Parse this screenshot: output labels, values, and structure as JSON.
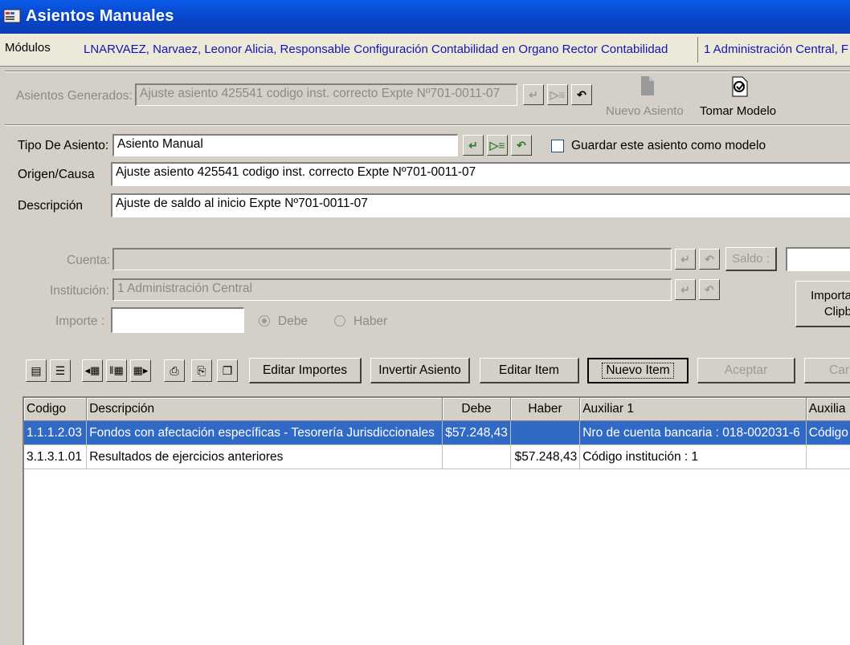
{
  "window": {
    "title": "Asientos Manuales"
  },
  "modules_bar": {
    "label": "Módulos",
    "user": "LNARVAEZ, Narvaez, Leonor Alicia, Responsable Configuración Contabilidad en Organo Rector Contabilidad",
    "institution": "1 Administración Central, F"
  },
  "generated": {
    "label": "Asientos Generados:",
    "value": "Ajuste asiento 425541 codigo inst. correcto Expte Nº701-0011-07",
    "new_entry_label": "Nuevo Asiento",
    "take_model_label": "Tomar Modelo"
  },
  "form": {
    "type_label": "Tipo De Asiento:",
    "type_value": "Asiento Manual",
    "save_model_label": "Guardar este asiento como modelo",
    "origin_label": "Origen/Causa",
    "origin_value": "Ajuste asiento 425541 codigo inst. correcto Expte Nº701-0011-07",
    "description_label": "Descripción",
    "description_value": "Ajuste de saldo al inicio Expte Nº701-0011-07"
  },
  "item": {
    "account_label": "Cuenta:",
    "account_value": "",
    "balance_label": "Saldo :",
    "institution_label": "Institución:",
    "institution_value": "1 Administración Central",
    "amount_label": "Importe :",
    "amount_value": "",
    "debit_label": "Debe",
    "credit_label": "Haber",
    "import_label_1": "Importa",
    "import_label_2": "Clipb"
  },
  "actions": {
    "edit_amounts": "Editar Importes",
    "invert_entry": "Invertir Asiento",
    "edit_item": "Editar Item",
    "new_item": "Nuevo Item",
    "accept": "Aceptar",
    "cancel": "Car"
  },
  "table": {
    "headers": [
      "Codigo",
      "Descripción",
      "Debe",
      "Haber",
      "Auxiliar 1",
      "Auxilia"
    ],
    "rows": [
      {
        "code": "1.1.1.2.03",
        "description": "Fondos con afectación específicas - Tesorería Jurisdiccionales",
        "debit": "$57.248,43",
        "credit": "",
        "aux1": "Nro de cuenta bancaria : 018-002031-6",
        "aux2": "Código"
      },
      {
        "code": "3.1.3.1.01",
        "description": "Resultados de ejercicios anteriores",
        "debit": "",
        "credit": "$57.248,43",
        "aux1": "Código institución  : 1",
        "aux2": ""
      }
    ]
  },
  "colors": {
    "titlebar": "#0a4fd8",
    "selection": "#3169c6",
    "link_text": "#1414b4",
    "panel": "#d4d0c8"
  }
}
